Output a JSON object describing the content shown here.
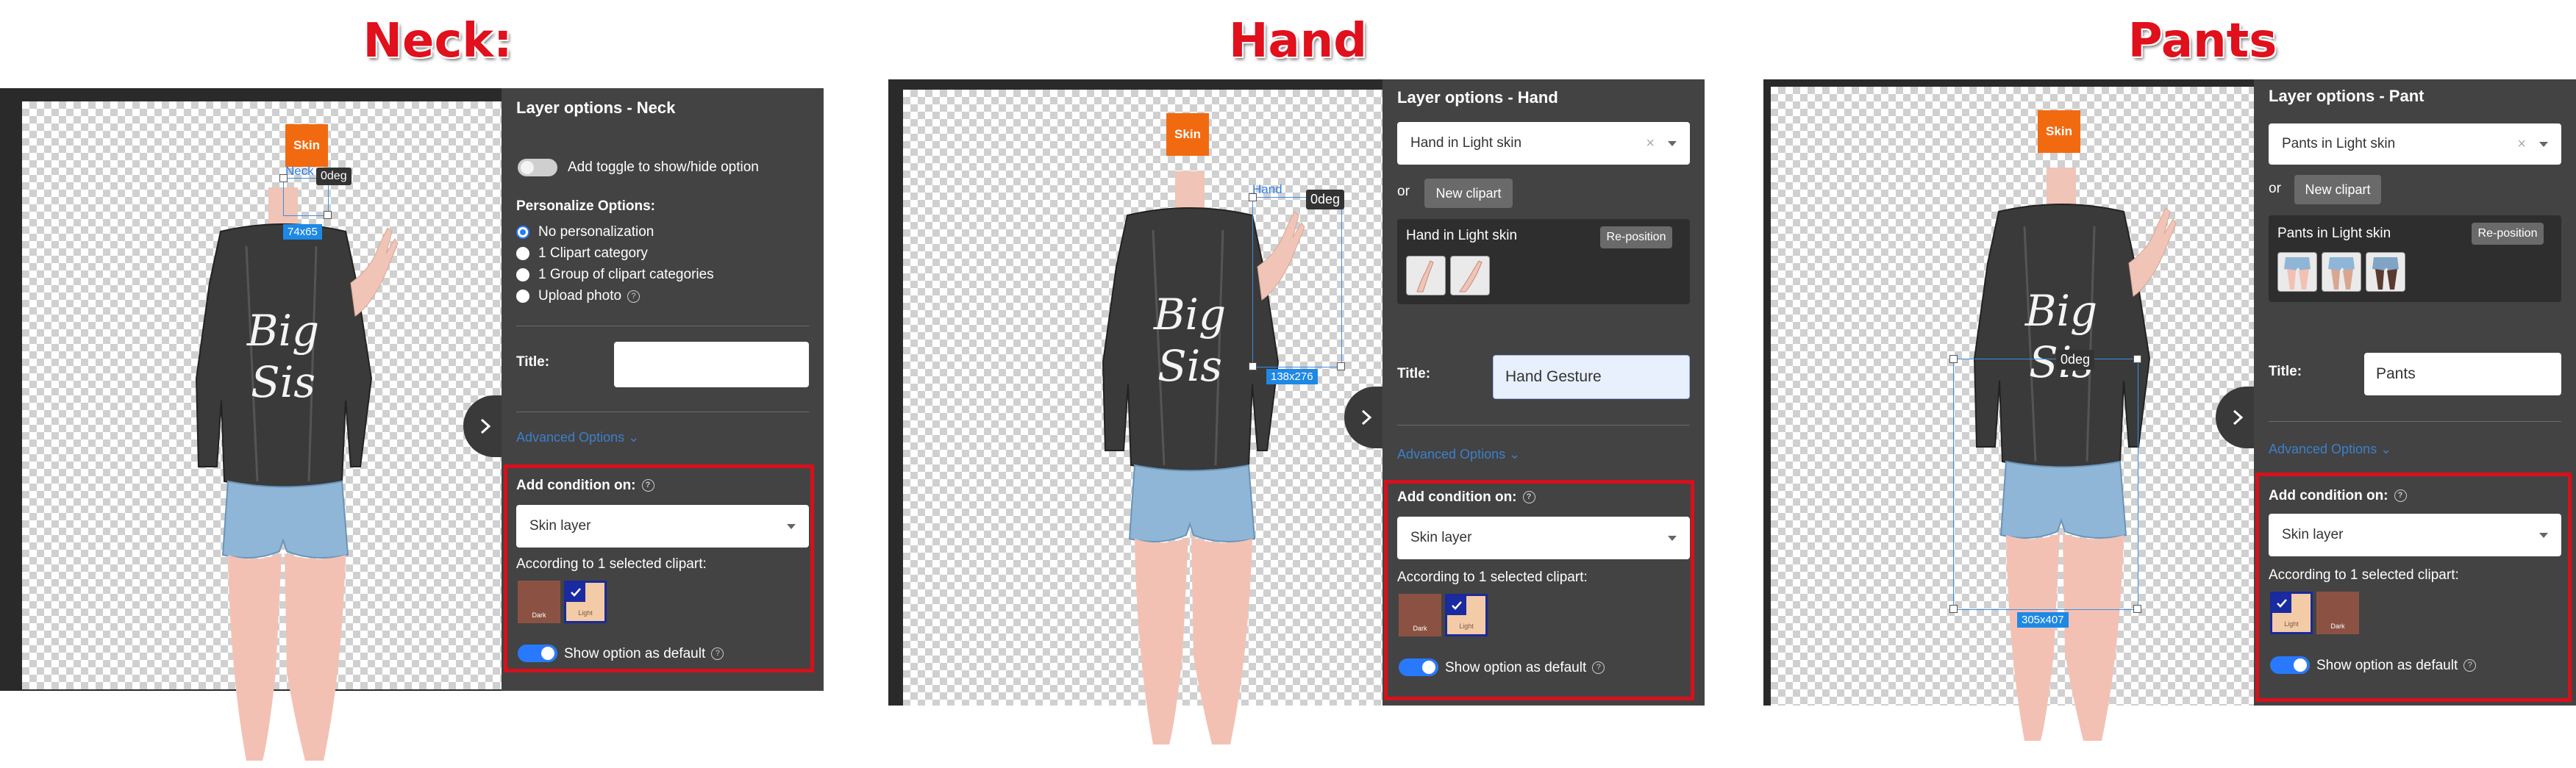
{
  "headings": {
    "neck": "Neck:",
    "hand": "Hand",
    "pants": "Pants"
  },
  "colors": {
    "heading": "#e0101c",
    "panel_bg": "#434343",
    "accent": "#2979ff",
    "highlight_border": "#d8101c",
    "skin_tag": "#f26a10"
  },
  "neck": {
    "skin_tag": "Skin",
    "selection": {
      "name": "Neck",
      "size": "74x65",
      "rotation": "0deg"
    },
    "panel_title": "Layer options - Neck",
    "toggle_label": "Add toggle to show/hide option",
    "personalize_label": "Personalize Options:",
    "options": [
      "No personalization",
      "1 Clipart category",
      "1 Group of clipart categories",
      "Upload photo"
    ],
    "title_label": "Title:",
    "title_value": "",
    "advanced": "Advanced Options",
    "condition_label": "Add condition on:",
    "condition_value": "Skin layer",
    "according_label": "According to 1 selected clipart:",
    "swatches": [
      {
        "label": "Dark",
        "color": "#8b5244",
        "selected": false
      },
      {
        "label": "Light",
        "color": "#f3cba6",
        "selected": true
      }
    ],
    "default_label": "Show option as default"
  },
  "hand": {
    "skin_tag": "Skin",
    "selection": {
      "name": "Hand",
      "size": "138x276",
      "rotation": "0deg"
    },
    "panel_title": "Layer options - Hand",
    "clipart_select": "Hand in Light skin",
    "or_label": "or",
    "new_clipart": "New clipart",
    "clipart_name": "Hand in Light skin",
    "reposition": "Re-position",
    "title_label": "Title:",
    "title_value": "Hand Gesture",
    "advanced": "Advanced Options",
    "condition_label": "Add condition on:",
    "condition_value": "Skin layer",
    "according_label": "According to 1 selected clipart:",
    "swatches": [
      {
        "label": "Dark",
        "color": "#8b5244",
        "selected": false
      },
      {
        "label": "Light",
        "color": "#f3cba6",
        "selected": true
      }
    ],
    "default_label": "Show option as default"
  },
  "pants": {
    "skin_tag": "Skin",
    "selection": {
      "size": "305x407",
      "rotation": "0deg"
    },
    "panel_title": "Layer options - Pant",
    "clipart_select": "Pants in Light skin",
    "or_label": "or",
    "new_clipart": "New clipart",
    "clipart_name": "Pants in Light skin",
    "reposition": "Re-position",
    "title_label": "Title:",
    "title_value": "Pants",
    "advanced": "Advanced Options",
    "condition_label": "Add condition on:",
    "condition_value": "Skin layer",
    "according_label": "According to 1 selected clipart:",
    "swatches": [
      {
        "label": "Light",
        "color": "#f3cba6",
        "selected": true
      },
      {
        "label": "Dark",
        "color": "#8b5244",
        "selected": false
      }
    ],
    "default_label": "Show option as default"
  }
}
